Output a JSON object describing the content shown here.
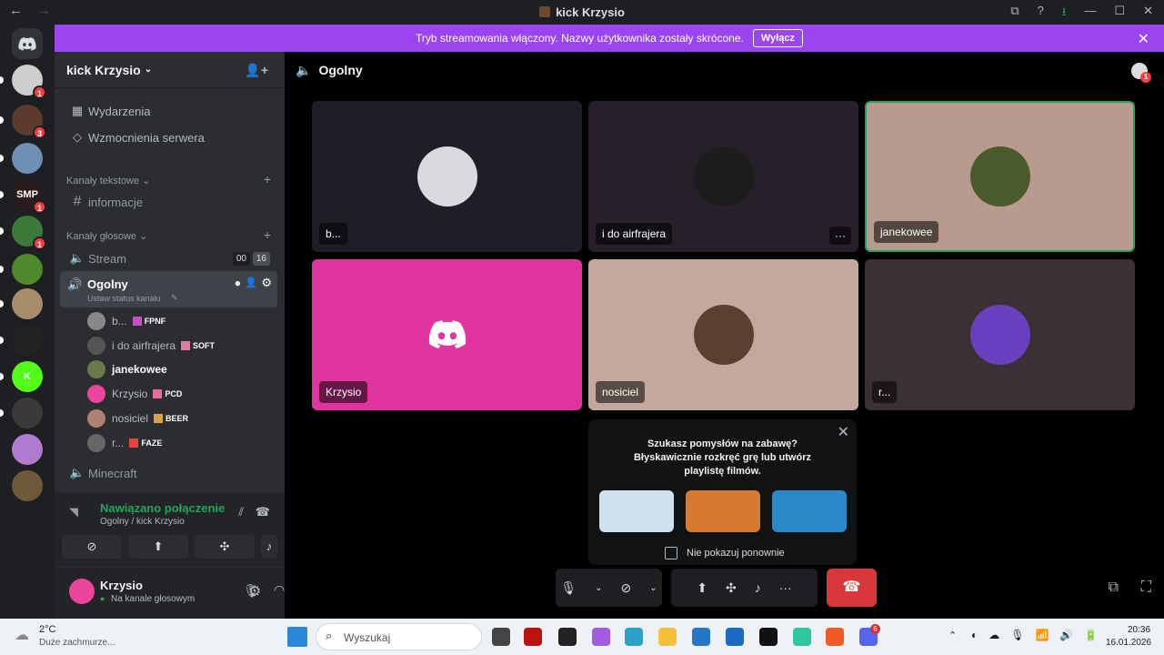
{
  "titlebar": {
    "back": "←",
    "forward": "→",
    "title": "kick Krzysio"
  },
  "banner": {
    "text": "Tryb streamowania włączony. Nazwy użytkownika zostały skrócone.",
    "button": "Wyłącz",
    "close": "✕"
  },
  "servers": [
    {
      "badge": "1",
      "color": "#cfcfcf"
    },
    {
      "badge": "3",
      "color": "#5a3b2e"
    },
    {
      "badge": "",
      "color": "#6e8fb3"
    },
    {
      "badge": "1",
      "color": "#2a1c1c",
      "label": "SMP"
    },
    {
      "badge": "1",
      "color": "#3c7a3a"
    },
    {
      "badge": "",
      "color": "#4f8a2a"
    },
    {
      "badge": "",
      "color": "#a88d6a"
    },
    {
      "badge": "",
      "color": "#222"
    },
    {
      "badge": "",
      "color": "#53fc18",
      "label": "K"
    },
    {
      "badge": "",
      "color": "#3a3a3a"
    },
    {
      "badge": "",
      "color": "#b07bd0"
    },
    {
      "badge": "",
      "color": "#6e5a3a"
    }
  ],
  "sidebar": {
    "guild_name": "kick Krzysio",
    "events": "Wydarzenia",
    "boosts": "Wzmocnienia serwera",
    "text_category": "Kanały tekstowe",
    "text_channel": "informacje",
    "voice_category": "Kanały głosowe",
    "stream_channel": "Stream",
    "stream_counts": [
      "00",
      "16"
    ],
    "active_channel": "Ogolny",
    "active_status": "Ustaw status kanału",
    "members": [
      {
        "name": "b...",
        "tag": "FPNF",
        "tagcolor": "#c94ec9",
        "color": "#888"
      },
      {
        "name": "i do airfrajera",
        "tag": "SOFT",
        "tagcolor": "#e07aa0",
        "color": "#555"
      },
      {
        "name": "janekowee",
        "tag": "",
        "tagcolor": "",
        "color": "#6a7a4a"
      },
      {
        "name": "Krzysio",
        "tag": "PCD",
        "tagcolor": "#e36ea0",
        "color": "#eb459e"
      },
      {
        "name": "nosiciel",
        "tag": "BEER",
        "tagcolor": "#d6a24a",
        "color": "#b08070"
      },
      {
        "name": "r...",
        "tag": "FAZE",
        "tagcolor": "#e0463d",
        "color": "#666"
      }
    ],
    "minecraft_channel": "Minecraft"
  },
  "voice": {
    "status": "Nawiązano połączenie",
    "location": "Ogolny / kick Krzysio"
  },
  "user": {
    "name": "Krzysio",
    "status": "Na kanale głosowym"
  },
  "main": {
    "channel": "Ogolny",
    "tiles": [
      {
        "name": "b...",
        "bg": "#1f1e26",
        "avatar": "#d9d9e0",
        "more": ""
      },
      {
        "name": "i do airfrajera",
        "bg": "#271f2a",
        "avatar": "#1c1c1c",
        "more": "···"
      },
      {
        "name": "janekowee",
        "bg": "#b89a8e",
        "avatar": "#4b5a2a",
        "more": ""
      },
      {
        "name": "Krzysio",
        "bg": "#e0359e",
        "avatar": "",
        "more": ""
      },
      {
        "name": "nosiciel",
        "bg": "#c4a89e",
        "avatar": "#5a4030",
        "more": ""
      },
      {
        "name": "r...",
        "bg": "#3a3036",
        "avatar": "#6a3fc0",
        "more": ""
      }
    ]
  },
  "popup": {
    "line1": "Szukasz pomysłów na zabawę?",
    "line2": "Błyskawicznie rozkręć grę lub utwórz playlistę filmów.",
    "checkbox": "Nie pokazuj ponownie",
    "games": [
      "#cfe0ee",
      "#d57a30",
      "#2a89c9"
    ]
  },
  "taskbar": {
    "temp": "2°C",
    "weather": "Duże zachmurze...",
    "search": "Wyszukaj",
    "time": "20:36",
    "date": "16.01.2026",
    "notif": "6"
  }
}
